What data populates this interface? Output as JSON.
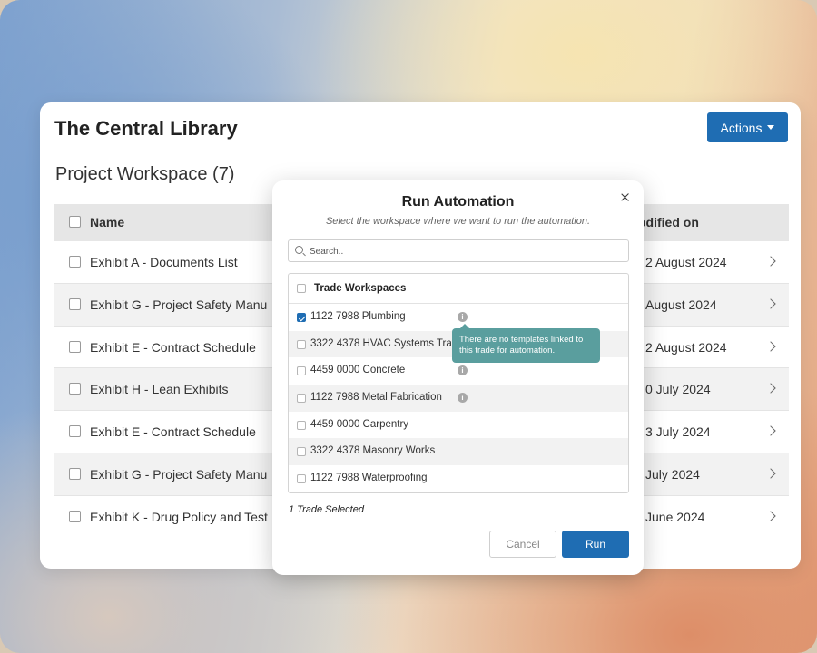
{
  "app": {
    "title": "The Central Library",
    "actions_label": "Actions"
  },
  "workspace": {
    "title": "Project Workspace (7)",
    "columns": {
      "name": "Name",
      "modified": "odified on"
    },
    "rows": [
      {
        "name": "Exhibit A - Documents List",
        "modified": "2 August 2024"
      },
      {
        "name": "Exhibit G - Project Safety Manu",
        "modified": "August 2024"
      },
      {
        "name": "Exhibit E - Contract Schedule",
        "modified": "2 August 2024"
      },
      {
        "name": "Exhibit H - Lean Exhibits",
        "modified": "0 July 2024"
      },
      {
        "name": "Exhibit E - Contract Schedule",
        "modified": "3 July 2024"
      },
      {
        "name": "Exhibit G - Project Safety Manu",
        "modified": "July 2024"
      },
      {
        "name": "Exhibit K - Drug Policy and Test",
        "modified": "June 2024"
      }
    ]
  },
  "modal": {
    "title": "Run Automation",
    "subtitle": "Select the workspace where we want to run the automation.",
    "search_placeholder": "Search..",
    "list_header": "Trade Workspaces",
    "items": [
      {
        "label": "1122 7988  Plumbing",
        "checked": true,
        "info": true
      },
      {
        "label": "3322 4378 HVAC Systems Tra",
        "checked": false,
        "info": false
      },
      {
        "label": "4459 0000 Concrete",
        "checked": false,
        "info": true
      },
      {
        "label": "1122 7988 Metal Fabrication",
        "checked": false,
        "info": true
      },
      {
        "label": "4459 0000 Carpentry",
        "checked": false,
        "info": false
      },
      {
        "label": "3322 4378 Masonry Works",
        "checked": false,
        "info": false
      },
      {
        "label": "1122 7988 Waterproofing",
        "checked": false,
        "info": false
      }
    ],
    "info_glyph": "i",
    "tooltip": "There are no templates linked to this trade for automation.",
    "selected_text": "1 Trade Selected",
    "cancel_label": "Cancel",
    "run_label": "Run"
  }
}
